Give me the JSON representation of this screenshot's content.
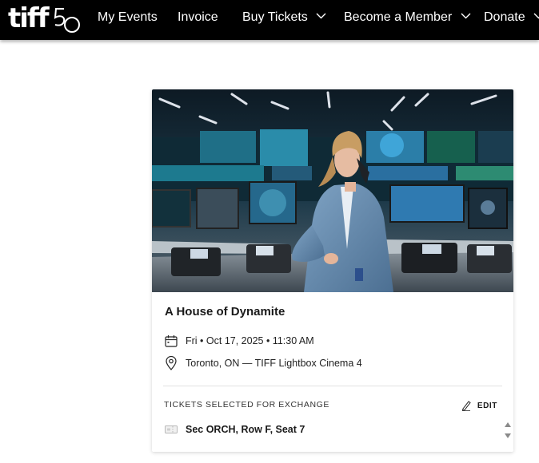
{
  "nav": {
    "logo_text": "tiff",
    "logo_number": "50",
    "items": [
      {
        "label": "My Events"
      },
      {
        "label": "Invoice"
      },
      {
        "label": "Buy Tickets"
      },
      {
        "label": "Become a Member"
      },
      {
        "label": "Donate"
      }
    ]
  },
  "event": {
    "title": "A House of Dynamite",
    "datetime": "Fri • Oct 17, 2025 • 11:30 AM",
    "venue": "Toronto, ON — TIFF Lightbox Cinema 4"
  },
  "exchange": {
    "label": "TICKETS SELECTED FOR EXCHANGE",
    "edit_label": "EDIT",
    "seat": "Sec ORCH, Row F, Seat 7"
  },
  "colors": {
    "nav_bg": "#000000",
    "nav_text": "#ffffff"
  },
  "icons": [
    "calendar-icon",
    "location-pin-icon",
    "pencil-icon",
    "ticket-icon",
    "chevron-down-icon"
  ]
}
